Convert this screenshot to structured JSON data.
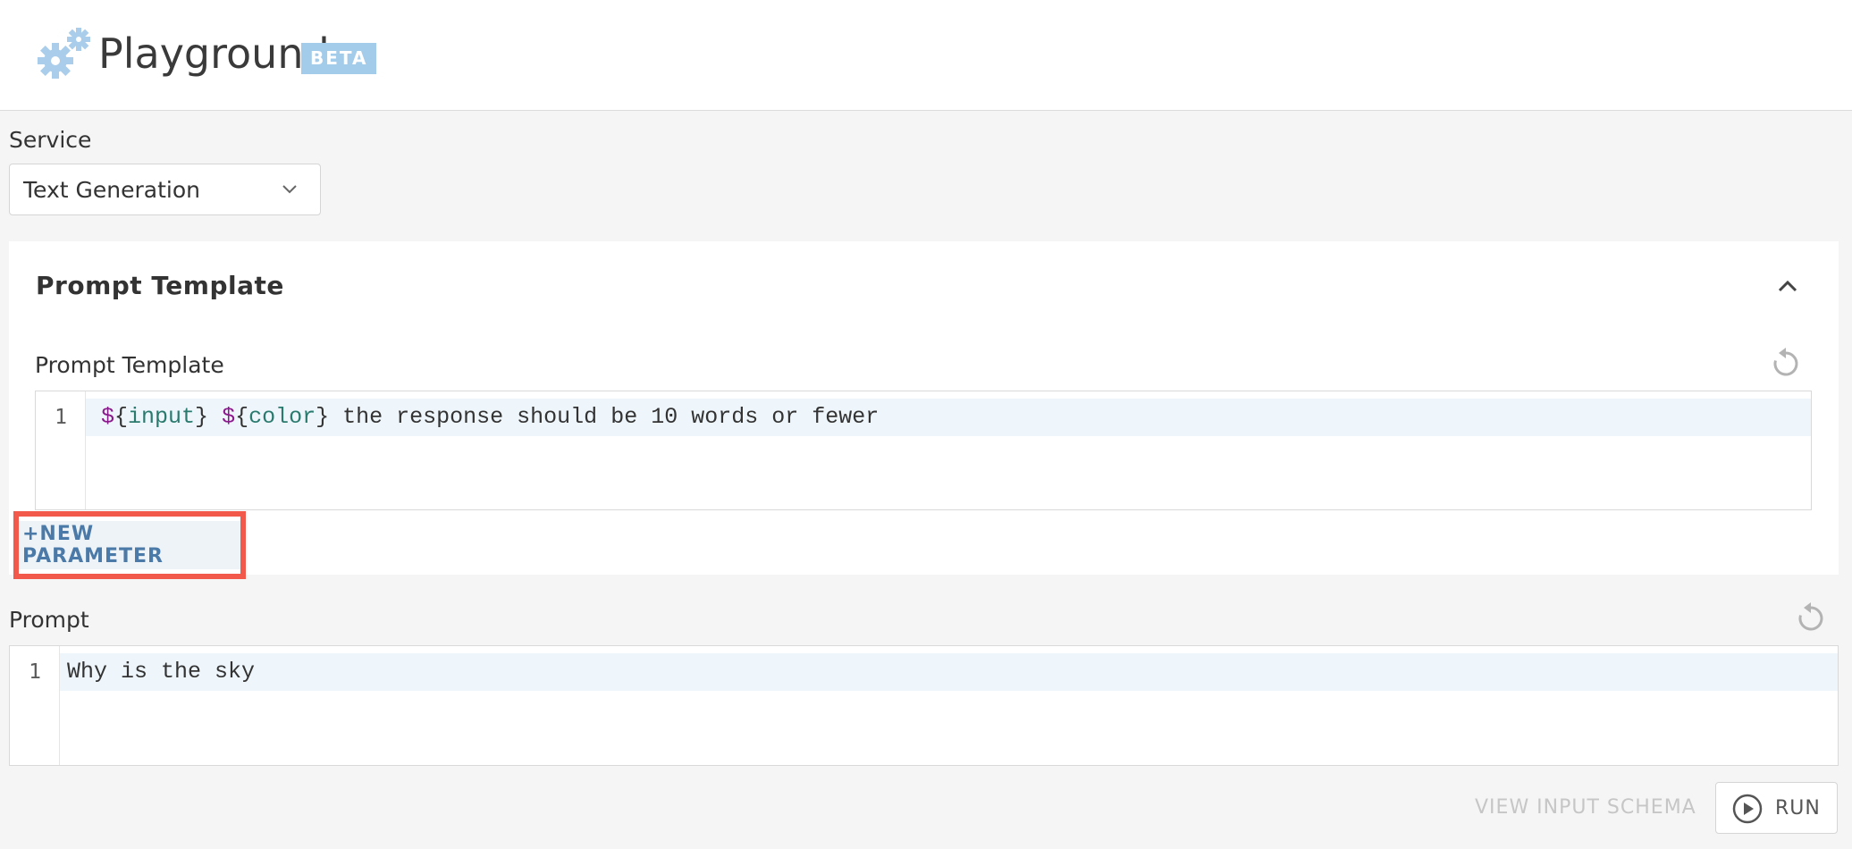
{
  "header": {
    "title": "Playground",
    "badge": "BETA",
    "icon": "gears-icon"
  },
  "service": {
    "label": "Service",
    "selected": "Text Generation"
  },
  "prompt_template_panel": {
    "title": "Prompt Template",
    "field_label": "Prompt Template",
    "editor": {
      "line_number": "1",
      "tokens": [
        {
          "text": "$",
          "kind": "dollar"
        },
        {
          "text": "{",
          "kind": "brace"
        },
        {
          "text": "input",
          "kind": "var"
        },
        {
          "text": "}",
          "kind": "brace"
        },
        {
          "text": " ",
          "kind": "plain"
        },
        {
          "text": "$",
          "kind": "dollar"
        },
        {
          "text": "{",
          "kind": "brace"
        },
        {
          "text": "color",
          "kind": "var"
        },
        {
          "text": "}",
          "kind": "brace"
        },
        {
          "text": " the response should be 10 words or fewer",
          "kind": "plain"
        }
      ]
    },
    "new_parameter_label": "+NEW PARAMETER"
  },
  "prompt": {
    "label": "Prompt",
    "line_number": "1",
    "code": "Why is the sky"
  },
  "footer": {
    "schema_link": "VIEW INPUT SCHEMA",
    "run_label": "RUN"
  },
  "colors": {
    "badge": "#a3cbea",
    "highlight_outline": "#f2594b",
    "link": "#4b7aa8",
    "active_line": "#eef6fc"
  }
}
